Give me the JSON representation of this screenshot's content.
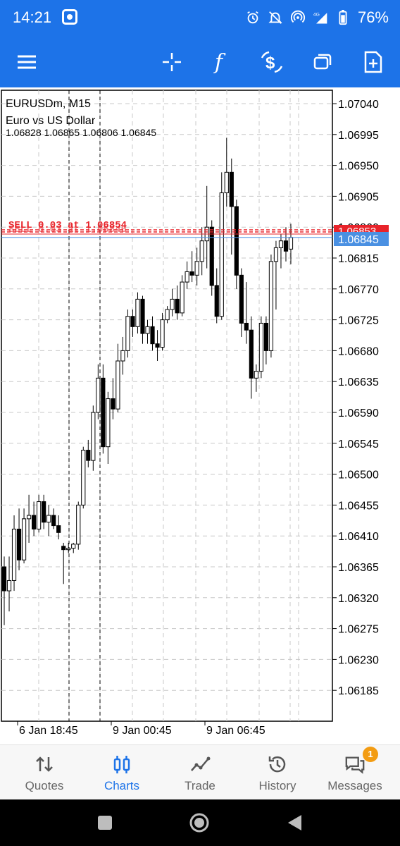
{
  "status_bar": {
    "time": "14:21",
    "network": "4G",
    "battery": "76%"
  },
  "chart": {
    "symbol_timeframe": "EURUSDm, M15",
    "description": "Euro vs US Dollar",
    "ohlc": "1.06828 1.06865 1.06806 1.06845",
    "order_label": "SELL 0.03 at 1.06854",
    "order_label_overlap": "SELL 0.03 at 1.06846",
    "ask_price_label": "1.06853",
    "bid_price_label": "1.06845",
    "price_levels": [
      "1.07040",
      "1.06995",
      "1.06950",
      "1.06905",
      "1.06860",
      "1.06815",
      "1.06770",
      "1.06725",
      "1.06680",
      "1.06635",
      "1.06590",
      "1.06545",
      "1.06500",
      "1.06455",
      "1.06410",
      "1.06365",
      "1.06320",
      "1.06275",
      "1.06230",
      "1.06185"
    ],
    "time_labels": [
      "6 Jan 18:45",
      "9 Jan 00:45",
      "9 Jan 06:45"
    ],
    "colors": {
      "order_line": "#e8232a",
      "bid_line": "#4a90e2",
      "grid": "#c8c8c8",
      "bid_label_bg": "#4a90e2",
      "ask_label_bg": "#e8232a"
    }
  },
  "chart_data": {
    "type": "candlestick",
    "y_axis_range": [
      1.0616,
      1.0706
    ],
    "candles": [
      [
        1.06365,
        1.0638,
        1.0628,
        1.0633
      ],
      [
        1.0633,
        1.0638,
        1.063,
        1.06345
      ],
      [
        1.06345,
        1.0644,
        1.0633,
        1.0642
      ],
      [
        1.0642,
        1.0645,
        1.0636,
        1.06375
      ],
      [
        1.06375,
        1.0645,
        1.0637,
        1.06435
      ],
      [
        1.06435,
        1.0647,
        1.064,
        1.0644
      ],
      [
        1.0644,
        1.0646,
        1.0641,
        1.0642
      ],
      [
        1.0642,
        1.0647,
        1.06415,
        1.0646
      ],
      [
        1.0646,
        1.0647,
        1.0642,
        1.0643
      ],
      [
        1.0643,
        1.06455,
        1.0641,
        1.0644
      ],
      [
        1.0644,
        1.0645,
        1.0642,
        1.06425
      ],
      [
        1.06425,
        1.0644,
        1.06405,
        1.06415
      ],
      [
        1.06395,
        1.064,
        1.0634,
        1.0639
      ],
      [
        1.0639,
        1.064,
        1.06385,
        1.06392
      ],
      [
        1.06392,
        1.064,
        1.06385,
        1.06398
      ],
      [
        1.06398,
        1.0646,
        1.0639,
        1.06455
      ],
      [
        1.06455,
        1.0654,
        1.0645,
        1.06535
      ],
      [
        1.06535,
        1.0655,
        1.0651,
        1.0652
      ],
      [
        1.0652,
        1.066,
        1.06505,
        1.0659
      ],
      [
        1.0659,
        1.0666,
        1.0658,
        1.0664
      ],
      [
        1.0664,
        1.0666,
        1.0653,
        1.0654
      ],
      [
        1.0654,
        1.0662,
        1.06515,
        1.0661
      ],
      [
        1.0661,
        1.0664,
        1.0658,
        1.06595
      ],
      [
        1.06595,
        1.0669,
        1.0659,
        1.06665
      ],
      [
        1.06665,
        1.067,
        1.06645,
        1.0668
      ],
      [
        1.0668,
        1.0674,
        1.0667,
        1.0673
      ],
      [
        1.0673,
        1.0674,
        1.067,
        1.06715
      ],
      [
        1.06715,
        1.06765,
        1.06705,
        1.06755
      ],
      [
        1.06755,
        1.0676,
        1.0669,
        1.06705
      ],
      [
        1.06705,
        1.06725,
        1.0669,
        1.06715
      ],
      [
        1.06715,
        1.0673,
        1.0668,
        1.0669
      ],
      [
        1.0669,
        1.0671,
        1.06665,
        1.06685
      ],
      [
        1.06685,
        1.06735,
        1.0668,
        1.06725
      ],
      [
        1.06725,
        1.06745,
        1.0672,
        1.0674
      ],
      [
        1.0674,
        1.0677,
        1.0673,
        1.06755
      ],
      [
        1.06755,
        1.06775,
        1.06725,
        1.06735
      ],
      [
        1.06735,
        1.0679,
        1.0673,
        1.0678
      ],
      [
        1.0678,
        1.0681,
        1.0677,
        1.06795
      ],
      [
        1.06795,
        1.06825,
        1.0678,
        1.0679
      ],
      [
        1.0679,
        1.0683,
        1.06775,
        1.0681
      ],
      [
        1.0681,
        1.0686,
        1.0679,
        1.0684
      ],
      [
        1.0684,
        1.0692,
        1.068,
        1.0686
      ],
      [
        1.0686,
        1.0687,
        1.0676,
        1.06775
      ],
      [
        1.06775,
        1.068,
        1.0672,
        1.0673
      ],
      [
        1.0673,
        1.0694,
        1.06725,
        1.0691
      ],
      [
        1.0691,
        1.0699,
        1.0689,
        1.0694
      ],
      [
        1.0694,
        1.0696,
        1.0682,
        1.0689
      ],
      [
        1.0689,
        1.069,
        1.0677,
        1.0679
      ],
      [
        1.0679,
        1.068,
        1.067,
        1.0672
      ],
      [
        1.0672,
        1.0678,
        1.0669,
        1.0671
      ],
      [
        1.0671,
        1.0673,
        1.0661,
        1.0664
      ],
      [
        1.0664,
        1.0666,
        1.0662,
        1.0665
      ],
      [
        1.0665,
        1.0673,
        1.0664,
        1.0672
      ],
      [
        1.0672,
        1.0673,
        1.0666,
        1.0668
      ],
      [
        1.0668,
        1.0682,
        1.0667,
        1.0681
      ],
      [
        1.0681,
        1.0684,
        1.0674,
        1.0683
      ],
      [
        1.0683,
        1.0685,
        1.068,
        1.0684
      ],
      [
        1.0684,
        1.0686,
        1.0681,
        1.06825
      ],
      [
        1.06828,
        1.06865,
        1.06806,
        1.06845
      ]
    ]
  },
  "bottom_nav": {
    "items": [
      {
        "label": "Quotes"
      },
      {
        "label": "Charts"
      },
      {
        "label": "Trade"
      },
      {
        "label": "History"
      },
      {
        "label": "Messages",
        "badge": "1"
      }
    ]
  }
}
